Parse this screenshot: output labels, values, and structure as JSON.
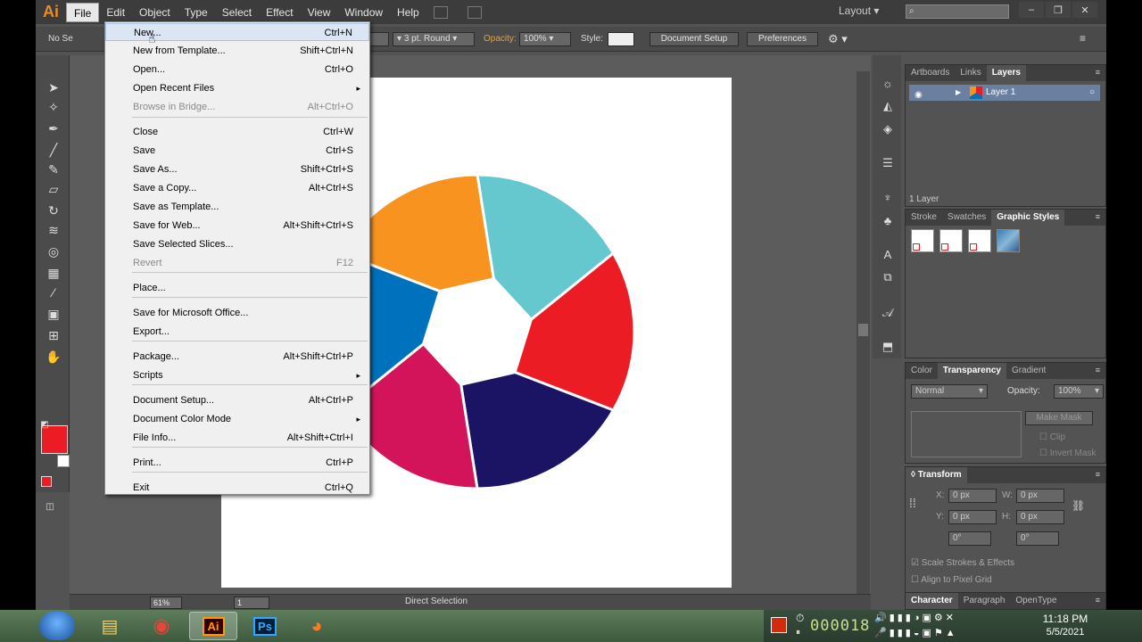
{
  "app": {
    "logo": "Ai",
    "menus": [
      "File",
      "Edit",
      "Object",
      "Type",
      "Select",
      "Effect",
      "View",
      "Window",
      "Help"
    ],
    "active_menu": "File",
    "workspace": "Layout"
  },
  "control_bar": {
    "selection_label": "No Se",
    "stroke_profile": "3 pt. Round",
    "opacity_label": "Opacity:",
    "opacity_value": "100%",
    "style_label": "Style:",
    "document_setup": "Document Setup",
    "preferences": "Preferences"
  },
  "file_menu": [
    {
      "label": "New...",
      "shortcut": "Ctrl+N",
      "hover": true
    },
    {
      "label": "New from Template...",
      "shortcut": "Shift+Ctrl+N"
    },
    {
      "label": "Open...",
      "shortcut": "Ctrl+O"
    },
    {
      "label": "Open Recent Files",
      "shortcut": "",
      "submenu": true
    },
    {
      "label": "Browse in Bridge...",
      "shortcut": "Alt+Ctrl+O",
      "disabled": true
    },
    {
      "label": "Close",
      "shortcut": "Ctrl+W"
    },
    {
      "label": "Save",
      "shortcut": "Ctrl+S"
    },
    {
      "label": "Save As...",
      "shortcut": "Shift+Ctrl+S"
    },
    {
      "label": "Save a Copy...",
      "shortcut": "Alt+Ctrl+S"
    },
    {
      "label": "Save as Template...",
      "shortcut": ""
    },
    {
      "label": "Save for Web...",
      "shortcut": "Alt+Shift+Ctrl+S"
    },
    {
      "label": "Save Selected Slices...",
      "shortcut": ""
    },
    {
      "label": "Revert",
      "shortcut": "F12",
      "disabled": true
    },
    {
      "label": "Place...",
      "shortcut": ""
    },
    {
      "label": "Save for Microsoft Office...",
      "shortcut": ""
    },
    {
      "label": "Export...",
      "shortcut": ""
    },
    {
      "label": "Package...",
      "shortcut": "Alt+Shift+Ctrl+P"
    },
    {
      "label": "Scripts",
      "shortcut": "",
      "submenu": true
    },
    {
      "label": "Document Setup...",
      "shortcut": "Alt+Ctrl+P"
    },
    {
      "label": "Document Color Mode",
      "shortcut": "",
      "submenu": true
    },
    {
      "label": "File Info...",
      "shortcut": "Alt+Shift+Ctrl+I"
    },
    {
      "label": "Print...",
      "shortcut": "Ctrl+P"
    },
    {
      "label": "Exit",
      "shortcut": "Ctrl+Q"
    }
  ],
  "layers_panel": {
    "tabs": [
      "Artboards",
      "Links",
      "Layers"
    ],
    "active_tab": "Layers",
    "layer_name": "Layer 1",
    "footer": "1 Layer"
  },
  "styles_panel": {
    "tabs": [
      "Stroke",
      "Swatches",
      "Graphic Styles"
    ],
    "active_tab": "Graphic Styles"
  },
  "transparency_panel": {
    "tabs": [
      "Color",
      "Transparency",
      "Gradient"
    ],
    "active_tab": "Transparency",
    "blend_mode": "Normal",
    "opacity_label": "Opacity:",
    "opacity_value": "100%",
    "make_mask": "Make Mask",
    "clip": "Clip",
    "invert_mask": "Invert Mask"
  },
  "transform_panel": {
    "title": "Transform",
    "x_label": "X:",
    "x_value": "0 px",
    "y_label": "Y:",
    "y_value": "0 px",
    "w_label": "W:",
    "w_value": "0 px",
    "h_label": "H:",
    "h_value": "0 px",
    "angle1": "0°",
    "angle2": "0°",
    "scale_strokes": "Scale Strokes & Effects",
    "align_pixel": "Align to Pixel Grid"
  },
  "character_panel": {
    "tabs": [
      "Character",
      "Paragraph",
      "OpenType"
    ],
    "active_tab": "Character"
  },
  "status_bar": {
    "zoom": "61%",
    "artboard": "1",
    "tool": "Direct Selection"
  },
  "taskbar": {
    "time": "11:18 PM",
    "date": "5/5/2021",
    "counter": "000018"
  },
  "colors": {
    "fill": "#ec1c24",
    "segment_red": "#ec1c24",
    "segment_navy": "#1b1464",
    "segment_crimson": "#d4145a",
    "segment_blue": "#0071bc",
    "segment_orange": "#f7931e",
    "segment_cyan": "#64c8ce"
  }
}
